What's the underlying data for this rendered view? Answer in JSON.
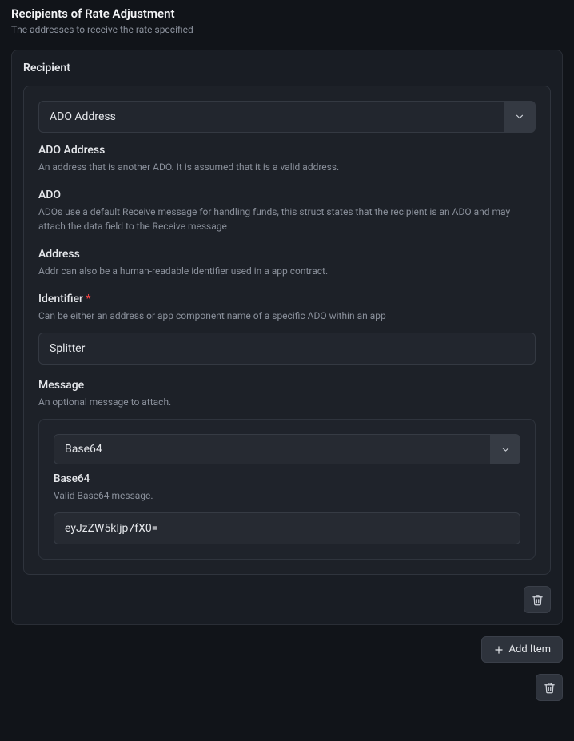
{
  "section": {
    "title": "Recipients of Rate Adjustment",
    "subtitle": "The addresses to receive the rate specified"
  },
  "recipient": {
    "title": "Recipient",
    "type_select": {
      "value": "ADO Address"
    },
    "ado_address": {
      "label": "ADO Address",
      "desc": "An address that is another ADO. It is assumed that it is a valid address."
    },
    "ado": {
      "label": "ADO",
      "desc": "ADOs use a default Receive message for handling funds, this struct states that the recipient is an ADO and may attach the data field to the Receive message"
    },
    "address": {
      "label": "Address",
      "desc": "Addr can also be a human-readable identifier used in a app contract."
    },
    "identifier": {
      "label": "Identifier",
      "desc": "Can be either an address or app component name of a specific ADO within an app",
      "value": "Splitter"
    },
    "message": {
      "label": "Message",
      "desc": "An optional message to attach.",
      "type_select": {
        "value": "Base64"
      },
      "base64": {
        "label": "Base64",
        "desc": "Valid Base64 message.",
        "value": "eyJzZW5kIjp7fX0="
      }
    }
  },
  "actions": {
    "add_item": "Add Item"
  }
}
